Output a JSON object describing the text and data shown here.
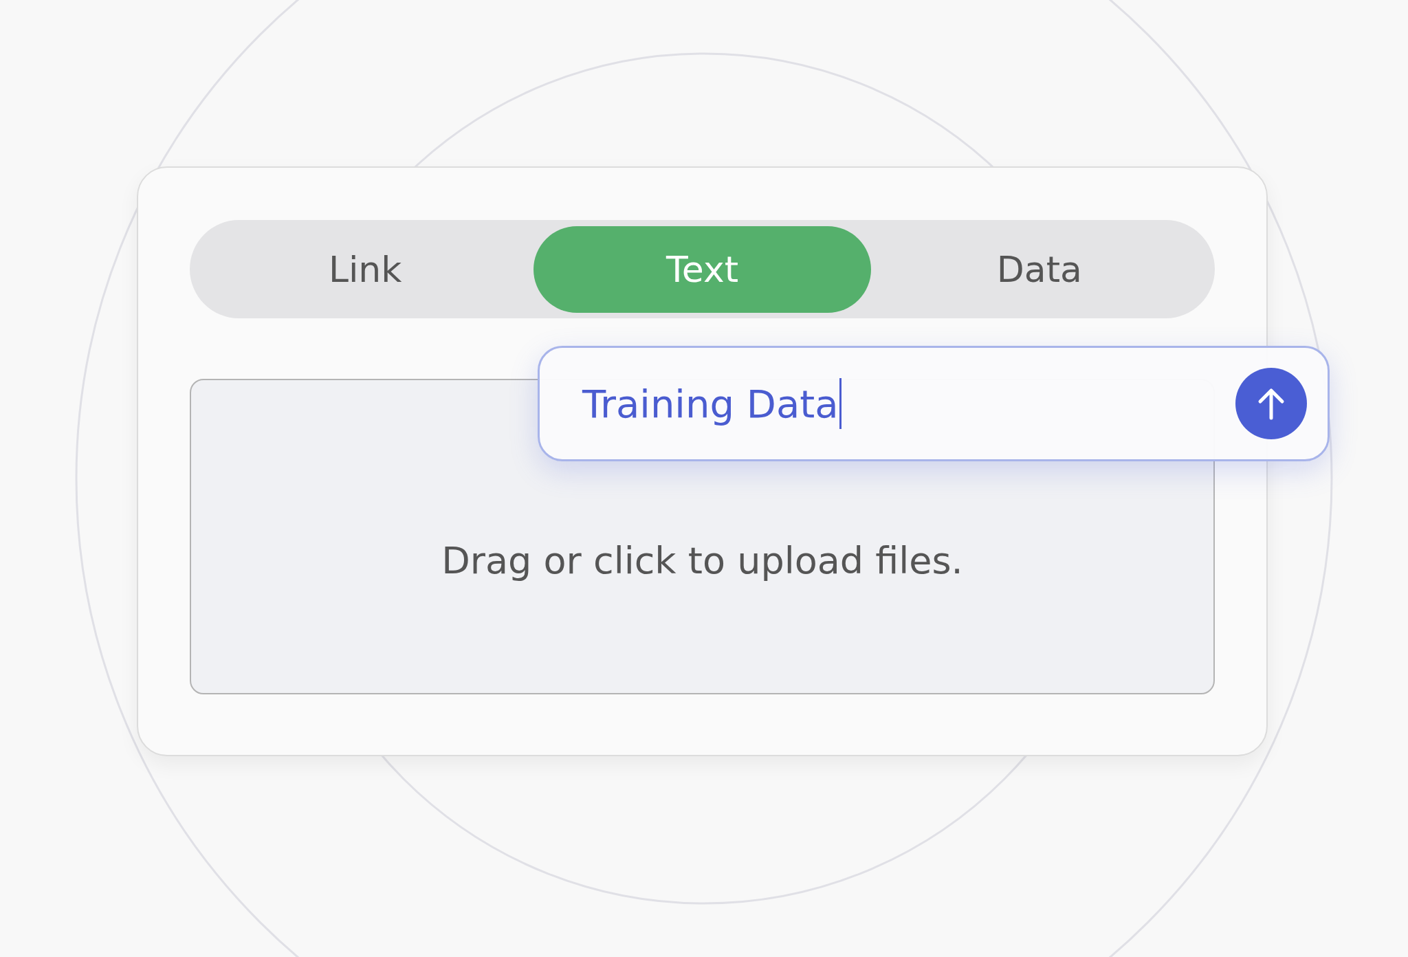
{
  "tabs": [
    {
      "label": "Link",
      "selected": false
    },
    {
      "label": "Text",
      "selected": true
    },
    {
      "label": "Data",
      "selected": false
    }
  ],
  "dropzone": {
    "text": "Drag or click to upload files."
  },
  "text_input": {
    "value": "Training Data",
    "focused": true
  }
}
